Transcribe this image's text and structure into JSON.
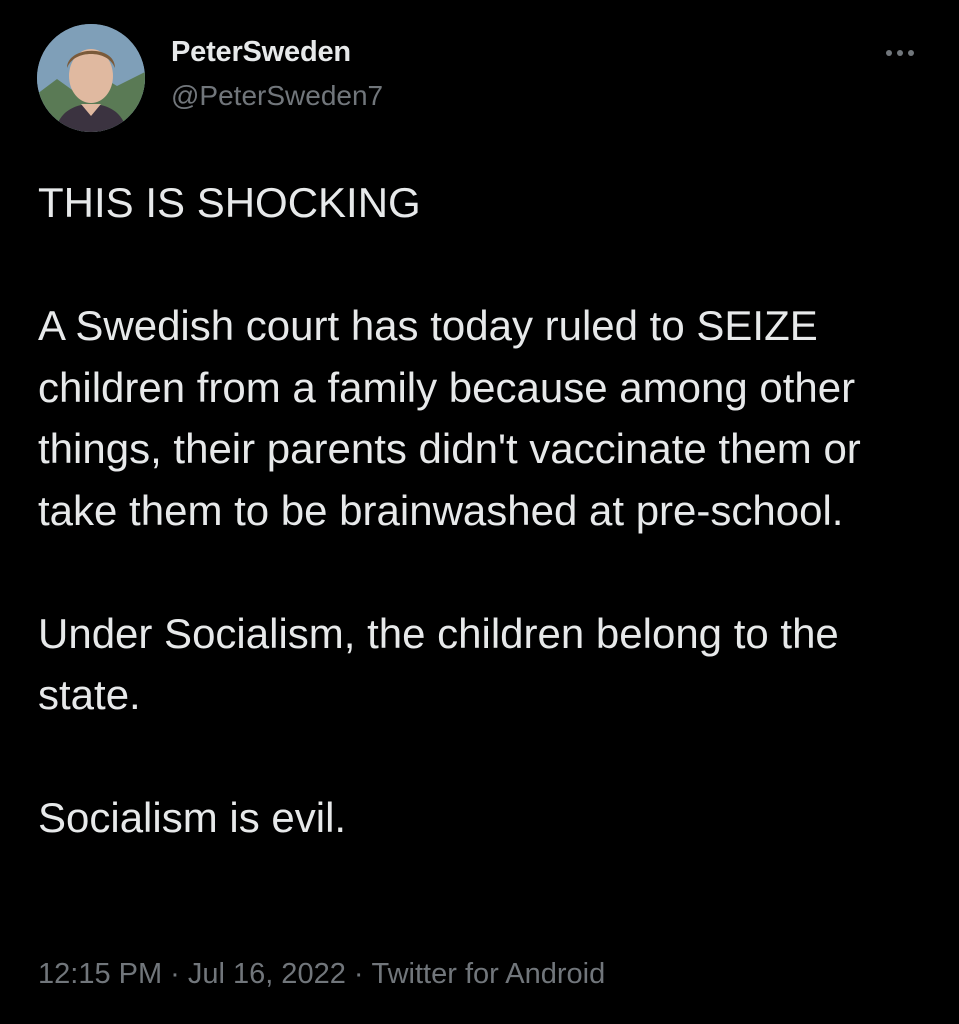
{
  "author": {
    "display_name": "PeterSweden",
    "handle": "@PeterSweden7"
  },
  "tweet": {
    "paragraphs": [
      "THIS IS SHOCKING",
      "A Swedish court has today ruled to SEIZE children from a family because among other things, their parents didn't vaccinate them or take them to be brainwashed at pre-school.",
      "Under Socialism, the children belong to the state.",
      "Socialism is evil."
    ]
  },
  "meta": {
    "time": "12:15 PM",
    "separator": "·",
    "date": "Jul 16, 2022",
    "source": "Twitter for Android"
  },
  "icons": {
    "more": "more-horizontal-icon"
  },
  "colors": {
    "background": "#000000",
    "text": "#e7e9ea",
    "secondary_text": "#71767b"
  }
}
